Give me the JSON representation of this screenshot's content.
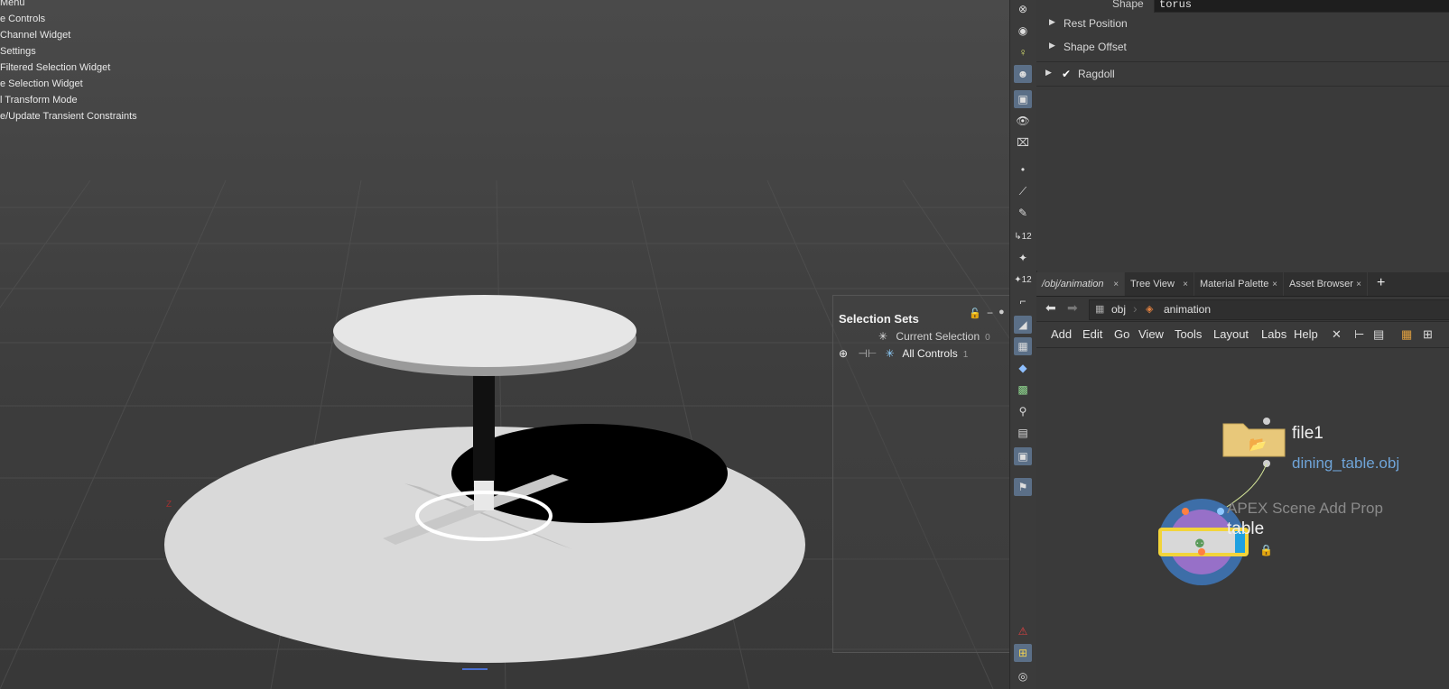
{
  "viewport": {
    "menu_items": [
      "Menu",
      "e Controls",
      "Channel Widget",
      "Settings",
      "Filtered Selection Widget",
      "e Selection Widget",
      "l Transform Mode",
      "e/Update Transient Constraints"
    ],
    "axis_label": "Z"
  },
  "selection_sets": {
    "title": "Selection Sets",
    "rows": [
      {
        "label": "Current Selection",
        "count": "0"
      },
      {
        "label": "All Controls",
        "count": "1"
      }
    ]
  },
  "params": {
    "shape_label": "Shape",
    "shape_value": "torus",
    "rest_position": "Rest Position",
    "shape_offset": "Shape Offset",
    "ragdoll": "Ragdoll"
  },
  "tabs": [
    {
      "label": "/obj/animation"
    },
    {
      "label": "Tree View"
    },
    {
      "label": "Material Palette"
    },
    {
      "label": "Asset Browser"
    }
  ],
  "path": {
    "obj": "obj",
    "node": "animation"
  },
  "network_menu": [
    "Add",
    "Edit",
    "Go",
    "View",
    "Tools",
    "Layout",
    "Labs",
    "Help"
  ],
  "nodes": {
    "file": {
      "name": "file1",
      "detail": "dining_table.obj"
    },
    "apex": {
      "type": "APEX Scene Add Prop",
      "name": "table"
    }
  },
  "colors": {
    "accent": "#5b6f87",
    "node_file": "#e8c87a",
    "node_selected": "#f2d43a",
    "detail_blue": "#6fa4d8"
  }
}
